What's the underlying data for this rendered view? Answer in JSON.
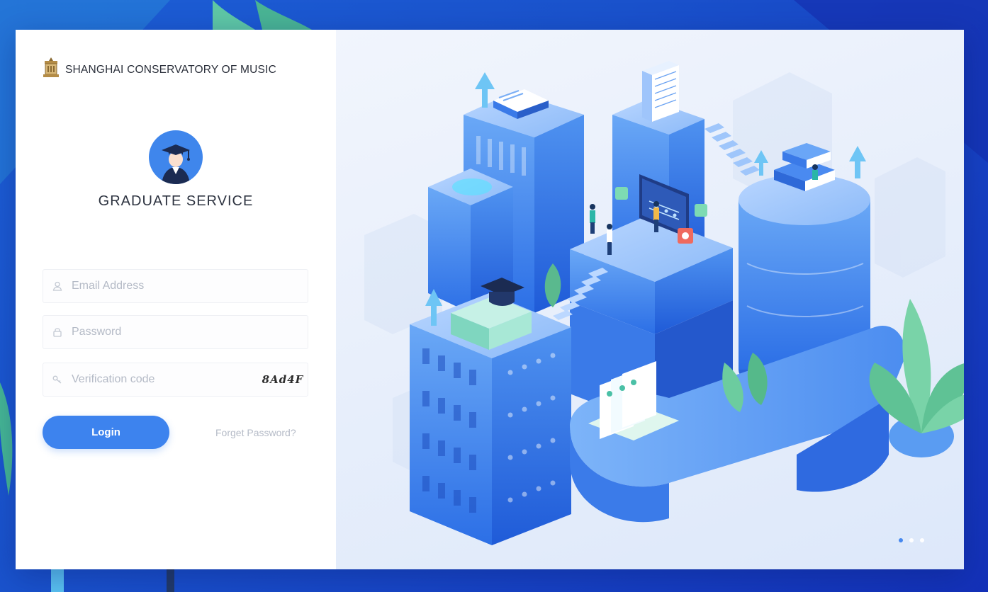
{
  "header": {
    "brand_name": "SHANGHAI CONSERVATORY OF MUSIC",
    "logo_icon": "conservatory-crest-icon"
  },
  "profile": {
    "avatar_icon": "graduate-avatar-icon",
    "title": "GRADUATE SERVICE"
  },
  "form": {
    "email": {
      "placeholder": "Email Address",
      "value": "",
      "icon": "user-icon"
    },
    "password": {
      "placeholder": "Password",
      "value": "",
      "icon": "lock-icon"
    },
    "verification": {
      "placeholder": "Verification code",
      "value": "",
      "icon": "key-icon",
      "captcha": "8Ad4F"
    },
    "login_label": "Login",
    "forget_label": "Forget Password?"
  },
  "carousel": {
    "count": 3,
    "active_index": 0
  },
  "colors": {
    "accent": "#3d83ee",
    "background": "#1a52cc",
    "text_dark": "#2d3340",
    "placeholder": "#b4bac6"
  }
}
